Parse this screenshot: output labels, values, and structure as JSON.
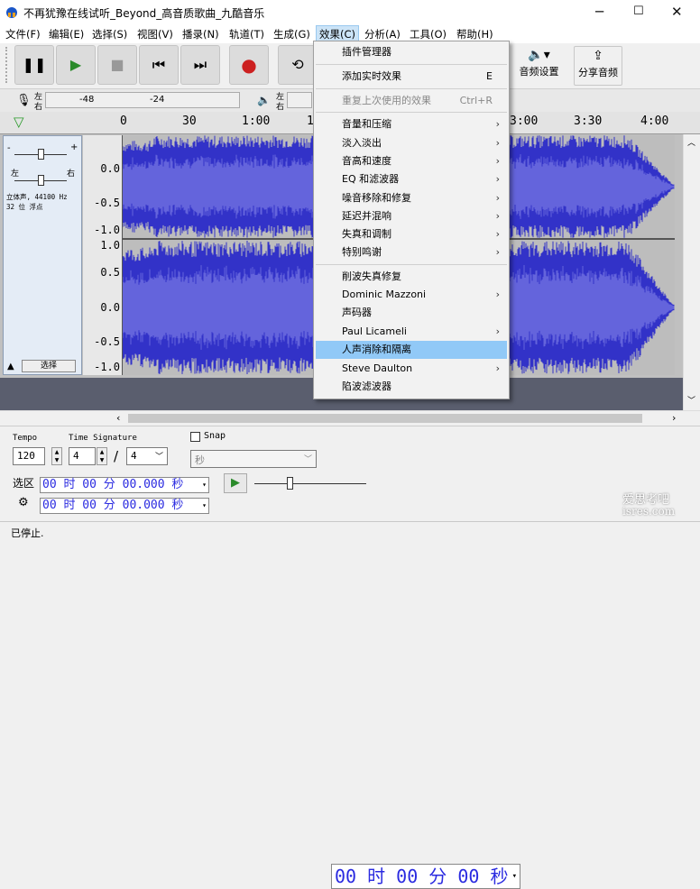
{
  "window": {
    "title": "不再犹豫在线试听_Beyond_高音质歌曲_九酷音乐",
    "minimize": "─",
    "maximize": "☐",
    "close": "✕"
  },
  "menubar": [
    {
      "label": "文件(F)"
    },
    {
      "label": "编辑(E)"
    },
    {
      "label": "选择(S)"
    },
    {
      "label": "视图(V)"
    },
    {
      "label": "播录(N)"
    },
    {
      "label": "轨道(T)"
    },
    {
      "label": "生成(G)"
    },
    {
      "label": "效果(C)"
    },
    {
      "label": "分析(A)"
    },
    {
      "label": "工具(O)"
    },
    {
      "label": "帮助(H)"
    }
  ],
  "toolbar": {
    "audio_setup": "音频设置",
    "share_audio": "分享音频"
  },
  "meters": {
    "rec_left": "左",
    "rec_right": "右",
    "rec_m48": "-48",
    "rec_m24": "-24",
    "play_left": "左",
    "play_right": "右"
  },
  "ruler": {
    "ticks": [
      "0",
      "30",
      "1:00",
      "1",
      "3:00",
      "3:30",
      "4:00"
    ]
  },
  "track": {
    "gain_minus": "-",
    "gain_plus": "+",
    "pan_left": "左",
    "pan_right": "右",
    "info_line1": "立体声, 44100 Hz",
    "info_line2": "32 位 浮点",
    "select_label": "选择",
    "scale": [
      "0.0",
      "-0.5",
      "-1.0",
      "1.0",
      "0.5",
      "0.0",
      "-0.5",
      "-1.0"
    ]
  },
  "effect_menu": {
    "items": [
      {
        "label": "插件管理器",
        "shortcut": "",
        "submenu": false,
        "disabled": false,
        "highlighted": false
      },
      {
        "label": "添加实时效果",
        "shortcut": "E",
        "submenu": false,
        "disabled": false,
        "highlighted": false
      },
      {
        "label": "重复上次使用的效果",
        "shortcut": "Ctrl+R",
        "submenu": false,
        "disabled": true,
        "highlighted": false
      },
      {
        "label": "音量和压缩",
        "shortcut": "",
        "submenu": true,
        "disabled": false,
        "highlighted": false
      },
      {
        "label": "淡入淡出",
        "shortcut": "",
        "submenu": true,
        "disabled": false,
        "highlighted": false
      },
      {
        "label": "音高和速度",
        "shortcut": "",
        "submenu": true,
        "disabled": false,
        "highlighted": false
      },
      {
        "label": "EQ 和滤波器",
        "shortcut": "",
        "submenu": true,
        "disabled": false,
        "highlighted": false
      },
      {
        "label": "噪音移除和修复",
        "shortcut": "",
        "submenu": true,
        "disabled": false,
        "highlighted": false
      },
      {
        "label": "延迟并混响",
        "shortcut": "",
        "submenu": true,
        "disabled": false,
        "highlighted": false
      },
      {
        "label": "失真和调制",
        "shortcut": "",
        "submenu": true,
        "disabled": false,
        "highlighted": false
      },
      {
        "label": "特别鸣谢",
        "shortcut": "",
        "submenu": true,
        "disabled": false,
        "highlighted": false
      },
      {
        "label": "削波失真修复",
        "shortcut": "",
        "submenu": false,
        "disabled": false,
        "highlighted": false
      },
      {
        "label": "Dominic Mazzoni",
        "shortcut": "",
        "submenu": true,
        "disabled": false,
        "highlighted": false
      },
      {
        "label": "声码器",
        "shortcut": "",
        "submenu": false,
        "disabled": false,
        "highlighted": false
      },
      {
        "label": "Paul Licameli",
        "shortcut": "",
        "submenu": true,
        "disabled": false,
        "highlighted": false
      },
      {
        "label": "人声消除和隔离",
        "shortcut": "",
        "submenu": false,
        "disabled": false,
        "highlighted": true
      },
      {
        "label": "Steve Daulton",
        "shortcut": "",
        "submenu": true,
        "disabled": false,
        "highlighted": false
      },
      {
        "label": "陷波滤波器",
        "shortcut": "",
        "submenu": false,
        "disabled": false,
        "highlighted": false
      }
    ],
    "arrow": "›"
  },
  "bottom": {
    "tempo_label": "Tempo",
    "tempo_value": "120",
    "timesig_label": "Time Signature",
    "timesig_num": "4",
    "timesig_slash": "/",
    "timesig_den": "4",
    "snap_label": "Snap",
    "snap_unit": "秒",
    "time_display": "00 时 00 分 00 秒",
    "selection_label": "选区",
    "sel_start": "00 时 00 分 00.000 秒",
    "sel_end": "00 时 00 分 00.000 秒"
  },
  "status": {
    "text": "已停止."
  },
  "watermark": {
    "line1": "爱思考吧",
    "line2": "isres.com"
  },
  "colors": {
    "wave": "#3232c8",
    "wave_light": "#6464dc",
    "highlight": "#91c9f7"
  }
}
